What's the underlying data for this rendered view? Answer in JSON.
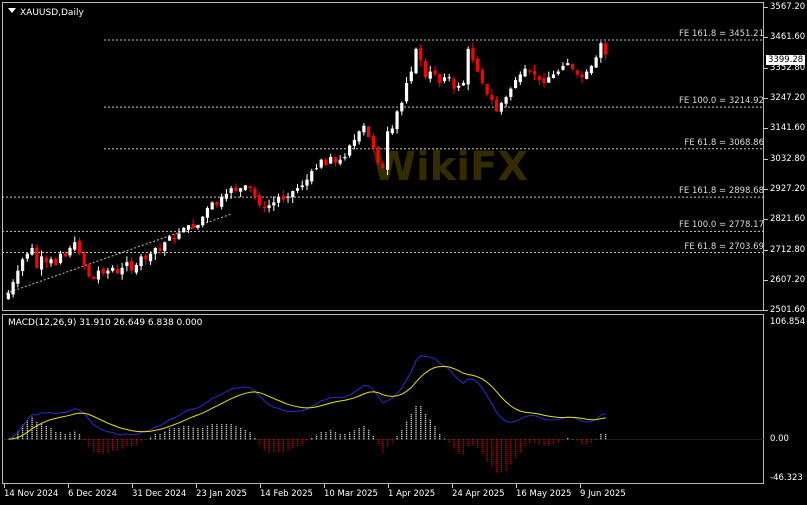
{
  "title": {
    "symbol_timeframe": "XAUUSD,Daily"
  },
  "macd_label": "MACD(12,26,9) 31.910 26.649 6.838 0.000",
  "current_price": "3399.28",
  "watermark": "WikiFX",
  "colors": {
    "background": "#000000",
    "frame": "#b8b8b8",
    "bull": "#ffffff",
    "bear": "#ff0000",
    "fe_line": "#c8c8c8",
    "macd_line": "#2a2ad8",
    "signal_line": "#e8e000",
    "hist_pos": "#ffffff",
    "hist_neg": "#ff0000"
  },
  "price_axis": [
    {
      "label": "3567.20",
      "value": 3567.2
    },
    {
      "label": "3461.60",
      "value": 3461.6
    },
    {
      "label": "3352.80",
      "value": 3352.8
    },
    {
      "label": "3247.20",
      "value": 3247.2
    },
    {
      "label": "3141.60",
      "value": 3141.6
    },
    {
      "label": "3032.80",
      "value": 3032.8
    },
    {
      "label": "2927.20",
      "value": 2927.2
    },
    {
      "label": "2821.60",
      "value": 2821.6
    },
    {
      "label": "2712.80",
      "value": 2712.8
    },
    {
      "label": "2607.20",
      "value": 2607.2
    },
    {
      "label": "2501.60",
      "value": 2501.6
    }
  ],
  "macd_axis": [
    {
      "label": "106.854",
      "value": 106.854
    },
    {
      "label": "0.00",
      "value": 0
    },
    {
      "label": "-46.323",
      "value": -46.323
    }
  ],
  "date_axis": [
    "14 Nov 2024",
    "6 Dec 2024",
    "31 Dec 2024",
    "23 Jan 2025",
    "14 Feb 2025",
    "10 Mar 2025",
    "1 Apr 2025",
    "24 Apr 2025",
    "16 May 2025",
    "9 Jun 2025"
  ],
  "fe_levels": [
    {
      "label": "FE 161.8 = 3451.21",
      "value": 3451.21
    },
    {
      "label": "FE 100.0 = 3214.92",
      "value": 3214.92
    },
    {
      "label": "FE 61.8 = 3068.86",
      "value": 3068.86
    },
    {
      "label": "FE 161.8 = 2898.68",
      "value": 2898.68
    },
    {
      "label": "FE 100.0 = 2778.17",
      "value": 2778.17
    },
    {
      "label": "FE 61.8 = 2703.69",
      "value": 2703.69
    }
  ],
  "chart_data": {
    "type": "candlestick",
    "ylim": [
      2501.6,
      3567.2
    ],
    "close_path": [
      2560,
      2600,
      2640,
      2680,
      2700,
      2720,
      2650,
      2690,
      2670,
      2680,
      2660,
      2700,
      2690,
      2720,
      2740,
      2700,
      2660,
      2620,
      2610,
      2640,
      2630,
      2640,
      2650,
      2630,
      2650,
      2670,
      2640,
      2660,
      2690,
      2680,
      2700,
      2720,
      2710,
      2740,
      2760,
      2750,
      2770,
      2790,
      2800,
      2790,
      2800,
      2830,
      2860,
      2880,
      2870,
      2900,
      2910,
      2930,
      2920,
      2930,
      2940,
      2930,
      2900,
      2870,
      2860,
      2870,
      2880,
      2900,
      2890,
      2900,
      2920,
      2930,
      2940,
      2960,
      2990,
      3000,
      3030,
      3010,
      3040,
      3020,
      3030,
      3040,
      3080,
      3100,
      3130,
      3150,
      3110,
      3070,
      3020,
      3000,
      3130,
      3140,
      3200,
      3230,
      3300,
      3340,
      3420,
      3380,
      3320,
      3340,
      3330,
      3300,
      3320,
      3320,
      3280,
      3290,
      3300,
      3420,
      3380,
      3340,
      3300,
      3260,
      3240,
      3200,
      3230,
      3250,
      3280,
      3310,
      3330,
      3350,
      3340,
      3330,
      3310,
      3300,
      3320,
      3330,
      3340,
      3360,
      3370,
      3350,
      3330,
      3320,
      3340,
      3360,
      3390,
      3440,
      3400
    ],
    "macd_ylim": [
      -46.323,
      106.854
    ]
  }
}
